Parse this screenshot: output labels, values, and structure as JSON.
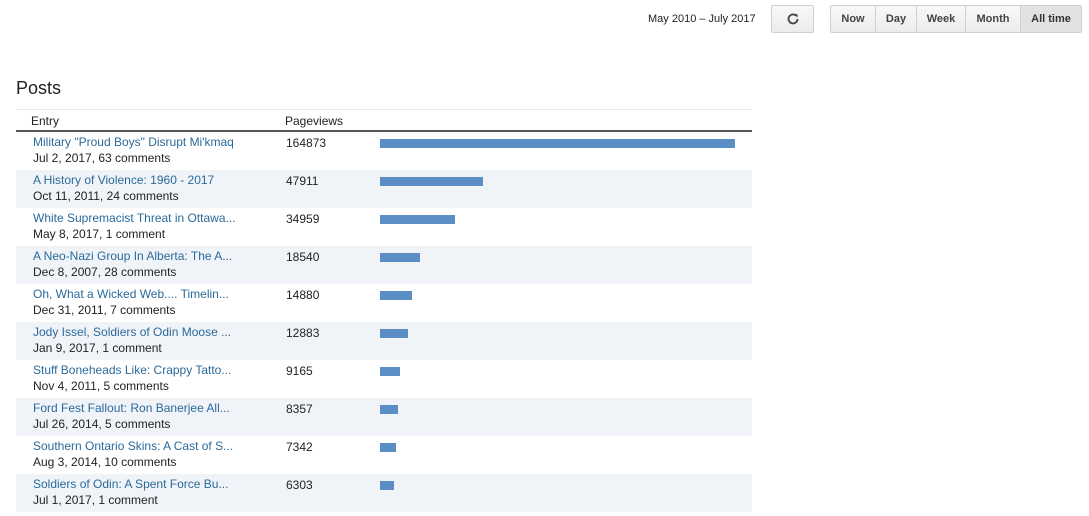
{
  "toolbar": {
    "date_range": "May 2010 – July 2017",
    "refresh_icon": "refresh-icon",
    "ranges": [
      {
        "label": "Now",
        "active": false
      },
      {
        "label": "Day",
        "active": false
      },
      {
        "label": "Week",
        "active": false
      },
      {
        "label": "Month",
        "active": false
      },
      {
        "label": "All time",
        "active": true
      }
    ]
  },
  "posts": {
    "title": "Posts",
    "columns": {
      "entry": "Entry",
      "pageviews": "Pageviews"
    },
    "bar_color": "#5b8ec4",
    "max_pageviews": 164873,
    "rows": [
      {
        "title": "Military \"Proud Boys\" Disrupt Mi'kmaq",
        "meta": "Jul 2, 2017, 63 comments",
        "pageviews": 164873
      },
      {
        "title": "A History of Violence: 1960 - 2017",
        "meta": "Oct 11, 2011, 24 comments",
        "pageviews": 47911
      },
      {
        "title": "White Supremacist Threat in Ottawa...",
        "meta": "May 8, 2017, 1 comment",
        "pageviews": 34959
      },
      {
        "title": "A Neo-Nazi Group In Alberta: The A...",
        "meta": "Dec 8, 2007, 28 comments",
        "pageviews": 18540
      },
      {
        "title": "Oh, What a Wicked Web.... Timelin...",
        "meta": "Dec 31, 2011, 7 comments",
        "pageviews": 14880
      },
      {
        "title": "Jody Issel, Soldiers of Odin Moose ...",
        "meta": "Jan 9, 2017, 1 comment",
        "pageviews": 12883
      },
      {
        "title": "Stuff Boneheads Like: Crappy Tatto...",
        "meta": "Nov 4, 2011, 5 comments",
        "pageviews": 9165
      },
      {
        "title": "Ford Fest Fallout: Ron Banerjee All...",
        "meta": "Jul 26, 2014, 5 comments",
        "pageviews": 8357
      },
      {
        "title": "Southern Ontario Skins: A Cast of S...",
        "meta": "Aug 3, 2014, 10 comments",
        "pageviews": 7342
      },
      {
        "title": "Soldiers of Odin: A Spent Force Bu...",
        "meta": "Jul 1, 2017, 1 comment",
        "pageviews": 6303
      }
    ]
  }
}
